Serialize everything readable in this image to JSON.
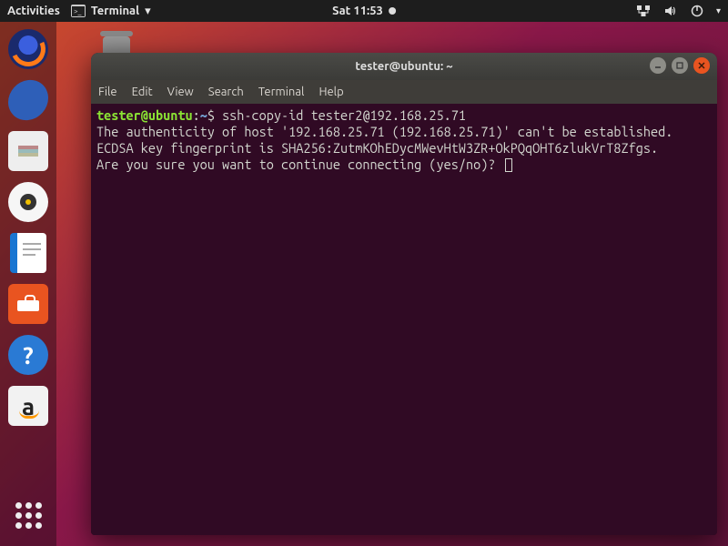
{
  "topbar": {
    "activities": "Activities",
    "app_name": "Terminal",
    "clock": "Sat 11:53"
  },
  "dock": {
    "items": [
      {
        "name": "firefox"
      },
      {
        "name": "thunderbird"
      },
      {
        "name": "files"
      },
      {
        "name": "rhythmbox"
      },
      {
        "name": "libreoffice-writer"
      },
      {
        "name": "ubuntu-software"
      },
      {
        "name": "help"
      },
      {
        "name": "amazon"
      }
    ]
  },
  "desktop": {
    "trash_label": "Trash"
  },
  "window": {
    "title": "tester@ubuntu: ~",
    "menus": [
      "File",
      "Edit",
      "View",
      "Search",
      "Terminal",
      "Help"
    ]
  },
  "terminal": {
    "prompt_user": "tester@ubuntu",
    "prompt_sep": ":",
    "prompt_path": "~",
    "prompt_end": "$ ",
    "command": "ssh-copy-id tester2@192.168.25.71",
    "lines": [
      "The authenticity of host '192.168.25.71 (192.168.25.71)' can't be established.",
      "ECDSA key fingerprint is SHA256:ZutmKOhEDycMWevHtW3ZR+OkPQqOHT6zlukVrT8Zfgs.",
      "Are you sure you want to continue connecting (yes/no)? "
    ]
  }
}
